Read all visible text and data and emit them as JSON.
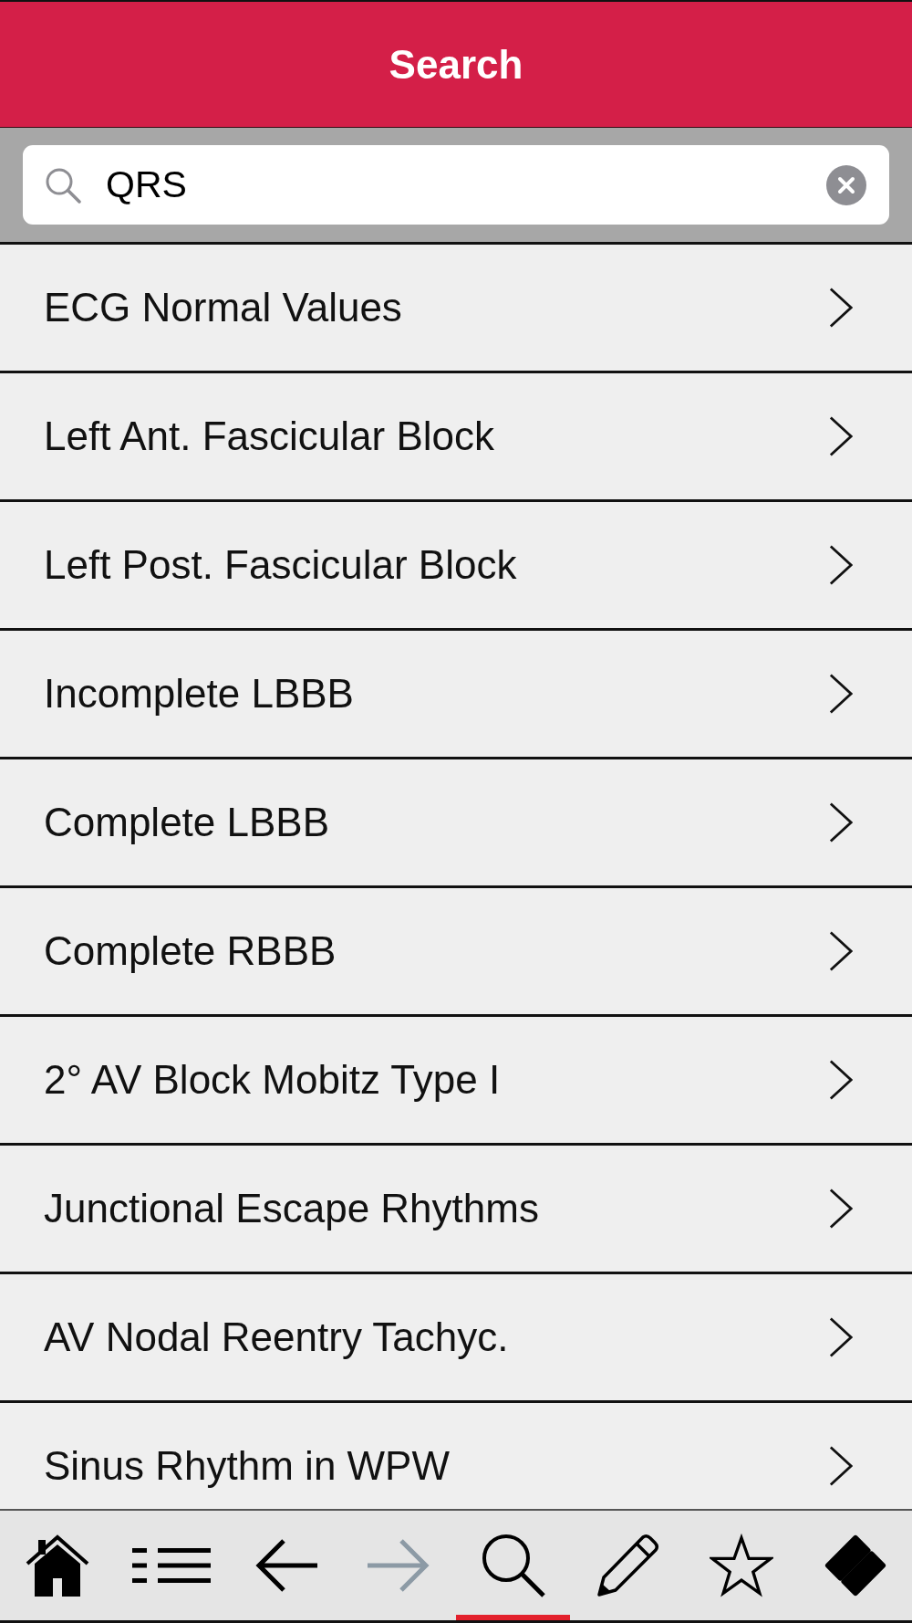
{
  "header": {
    "title": "Search"
  },
  "search": {
    "value": "QRS"
  },
  "results": [
    {
      "label": "ECG Normal Values"
    },
    {
      "label": "Left Ant. Fascicular Block"
    },
    {
      "label": "Left Post. Fascicular Block"
    },
    {
      "label": "Incomplete LBBB"
    },
    {
      "label": "Complete LBBB"
    },
    {
      "label": "Complete RBBB"
    },
    {
      "label": "2° AV Block Mobitz Type I"
    },
    {
      "label": "Junctional Escape Rhythms"
    },
    {
      "label": "AV Nodal Reentry Tachyc."
    },
    {
      "label": "Sinus Rhythm in WPW"
    }
  ],
  "toolbar": [
    {
      "kind": "home",
      "selected": false,
      "disabled": false
    },
    {
      "kind": "list",
      "selected": false,
      "disabled": false
    },
    {
      "kind": "back",
      "selected": false,
      "disabled": false
    },
    {
      "kind": "forward",
      "selected": false,
      "disabled": true
    },
    {
      "kind": "search",
      "selected": true,
      "disabled": false
    },
    {
      "kind": "pencil",
      "selected": false,
      "disabled": false
    },
    {
      "kind": "star",
      "selected": false,
      "disabled": false
    },
    {
      "kind": "eraser",
      "selected": false,
      "disabled": false
    }
  ]
}
